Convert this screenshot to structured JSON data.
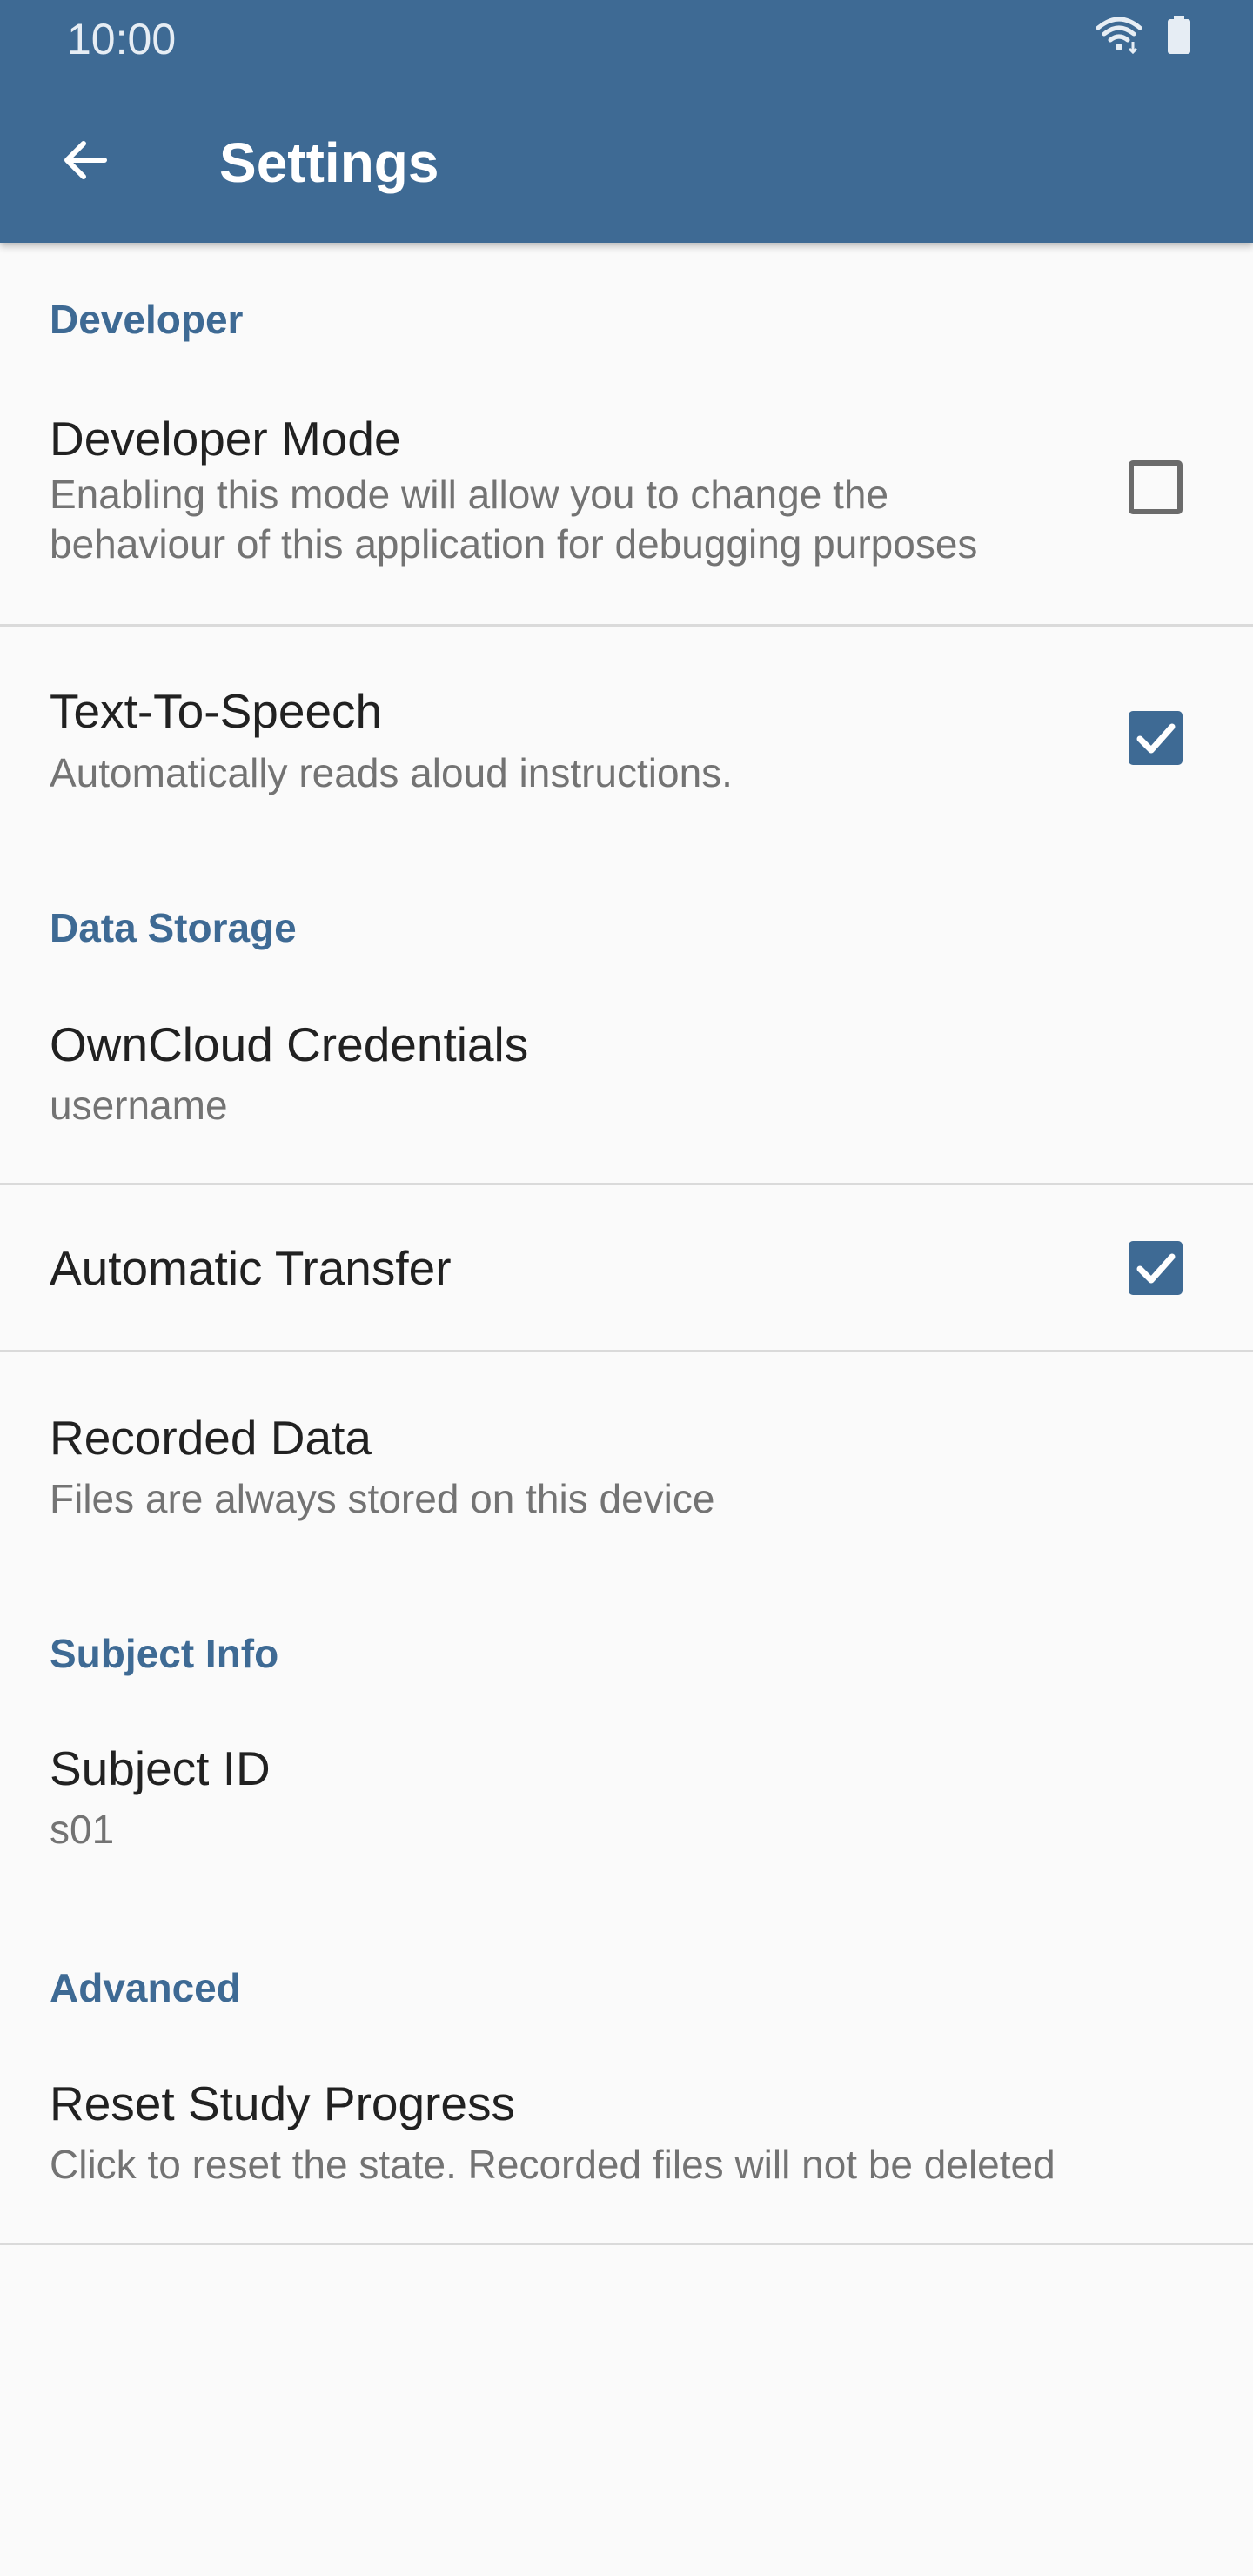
{
  "status_bar": {
    "time": "10:00",
    "icons": [
      "wifi-icon",
      "battery-icon"
    ]
  },
  "app_bar": {
    "title": "Settings",
    "back_icon": "arrow-back-icon"
  },
  "colors": {
    "primary": "#3e6a94",
    "background": "#fafafa",
    "title_text": "#212121",
    "summary_text": "#737373",
    "divider": "#dadada"
  },
  "sections": {
    "developer": {
      "header": "Developer",
      "developer_mode": {
        "title": "Developer Mode",
        "summary_line1": "Enabling this mode will allow you to change the",
        "summary_line2": "behaviour of this application for debugging purposes",
        "checked": false
      },
      "tts": {
        "title": "Text-To-Speech",
        "summary": "Automatically reads aloud instructions.",
        "checked": true
      }
    },
    "data_storage": {
      "header": "Data Storage",
      "owncloud": {
        "title": "OwnCloud Credentials",
        "summary": "username"
      },
      "auto_transfer": {
        "title": "Automatic Transfer",
        "checked": true
      },
      "recorded_data": {
        "title": "Recorded Data",
        "summary": "Files are always stored on this device"
      }
    },
    "subject_info": {
      "header": "Subject Info",
      "subject_id": {
        "title": "Subject ID",
        "summary": "s01"
      }
    },
    "advanced": {
      "header": "Advanced",
      "reset": {
        "title": "Reset Study Progress",
        "summary": "Click to reset the state. Recorded files will not be deleted"
      }
    }
  }
}
